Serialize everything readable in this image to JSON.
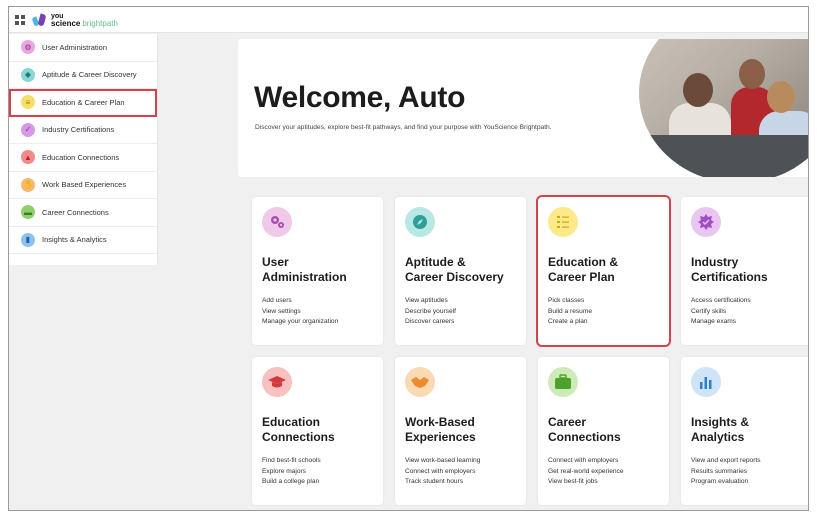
{
  "app": {
    "logo_you": "you",
    "logo_science": "science",
    "logo_brightpath": "brightpath"
  },
  "sidebar": {
    "items": [
      {
        "label": "User Administration",
        "icon": "gears-icon",
        "color": "#e9a6df"
      },
      {
        "label": "Aptitude & Career Discovery",
        "icon": "compass-icon",
        "color": "#8ad6d3"
      },
      {
        "label": "Education & Career Plan",
        "icon": "checklist-icon",
        "color": "#f4df6a"
      },
      {
        "label": "Industry Certifications",
        "icon": "badge-icon",
        "color": "#d59ae6"
      },
      {
        "label": "Education Connections",
        "icon": "graduation-cap-icon",
        "color": "#f28a8a"
      },
      {
        "label": "Work Based Experiences",
        "icon": "handshake-icon",
        "color": "#f7b777"
      },
      {
        "label": "Career Connections",
        "icon": "briefcase-icon",
        "color": "#8fcf6d"
      },
      {
        "label": "Insights & Analytics",
        "icon": "bar-chart-icon",
        "color": "#8cc2f0"
      }
    ],
    "active_index": 2
  },
  "hero": {
    "title": "Welcome, Auto",
    "subtitle": "Discover your aptitudes, explore best-fit pathways, and find your purpose with YouScience Brightpath."
  },
  "cards": [
    {
      "title_l1": "User",
      "title_l2": "Administration",
      "links": [
        "Add users",
        "View settings",
        "Manage your organization"
      ],
      "icon": "gears-icon",
      "color": "#f0c8ea",
      "accent": "#a64fb0"
    },
    {
      "title_l1": "Aptitude &",
      "title_l2": "Career Discovery",
      "links": [
        "View aptitudes",
        "Describe yourself",
        "Discover careers"
      ],
      "icon": "compass-icon",
      "color": "#b8e8e4",
      "accent": "#2d9e9a"
    },
    {
      "title_l1": "Education &",
      "title_l2": "Career Plan",
      "links": [
        "Pick classes",
        "Build a resume",
        "Create a plan"
      ],
      "icon": "checklist-icon",
      "color": "#fbe98a",
      "accent": "#d6a800"
    },
    {
      "title_l1": "Industry",
      "title_l2": "Certifications",
      "links": [
        "Access certifications",
        "Certify skills",
        "Manage exams"
      ],
      "icon": "badge-icon",
      "color": "#e9c6f2",
      "accent": "#a14ec2"
    },
    {
      "title_l1": "Education",
      "title_l2": "Connections",
      "links": [
        "Find best-fit schools",
        "Explore majors",
        "Build a college plan"
      ],
      "icon": "graduation-cap-icon",
      "color": "#f9c0c0",
      "accent": "#d3393f"
    },
    {
      "title_l1": "Work-Based",
      "title_l2": "Experiences",
      "links": [
        "View work-based learning",
        "Connect with employers",
        "Track student hours"
      ],
      "icon": "handshake-icon",
      "color": "#fbd9b3",
      "accent": "#ee8a2d"
    },
    {
      "title_l1": "Career",
      "title_l2": "Connections",
      "links": [
        "Connect with employers",
        "Get real-world experience",
        "View best-fit jobs"
      ],
      "icon": "briefcase-icon",
      "color": "#cdebb8",
      "accent": "#4ea12c"
    },
    {
      "title_l1": "Insights &",
      "title_l2": "Analytics",
      "links": [
        "View and export reports",
        "Results summaries",
        "Program evaluation"
      ],
      "icon": "bar-chart-icon",
      "color": "#cfe4f8",
      "accent": "#2f7fd0"
    }
  ],
  "highlight_color": "#d4434a"
}
